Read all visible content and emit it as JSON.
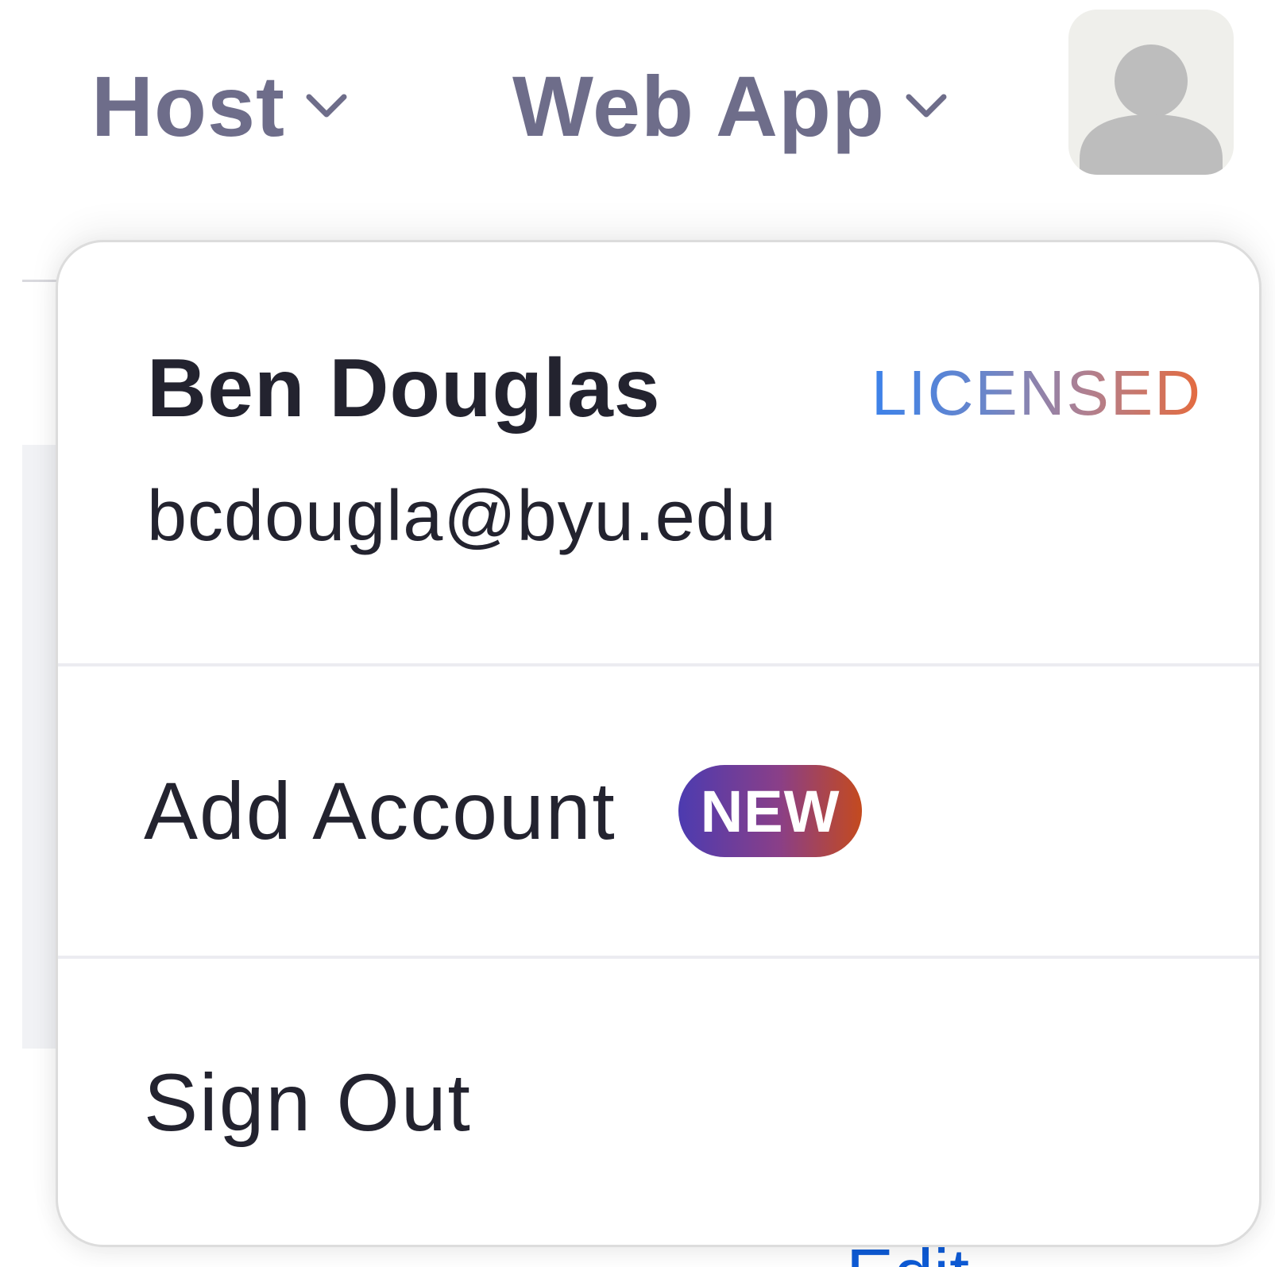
{
  "nav": {
    "host_label": "Host",
    "webapp_label": "Web App"
  },
  "avatar": {
    "icon": "user-avatar-icon"
  },
  "menu": {
    "profile": {
      "name": "Ben Douglas",
      "email": "bcdougla@byu.edu",
      "license": "LICENSED"
    },
    "add_account": {
      "label": "Add Account",
      "badge": "NEW"
    },
    "sign_out": {
      "label": "Sign Out"
    }
  },
  "background": {
    "partial_link": "Edit"
  },
  "colors": {
    "nav_text": "#6e6d8a",
    "primary_text": "#23232f",
    "license_gradient_start": "#3c82ea",
    "license_gradient_end": "#e56b3e",
    "new_badge_start": "#4c3bb0",
    "new_badge_end": "#c44a1e",
    "link": "#0e5bd6"
  }
}
